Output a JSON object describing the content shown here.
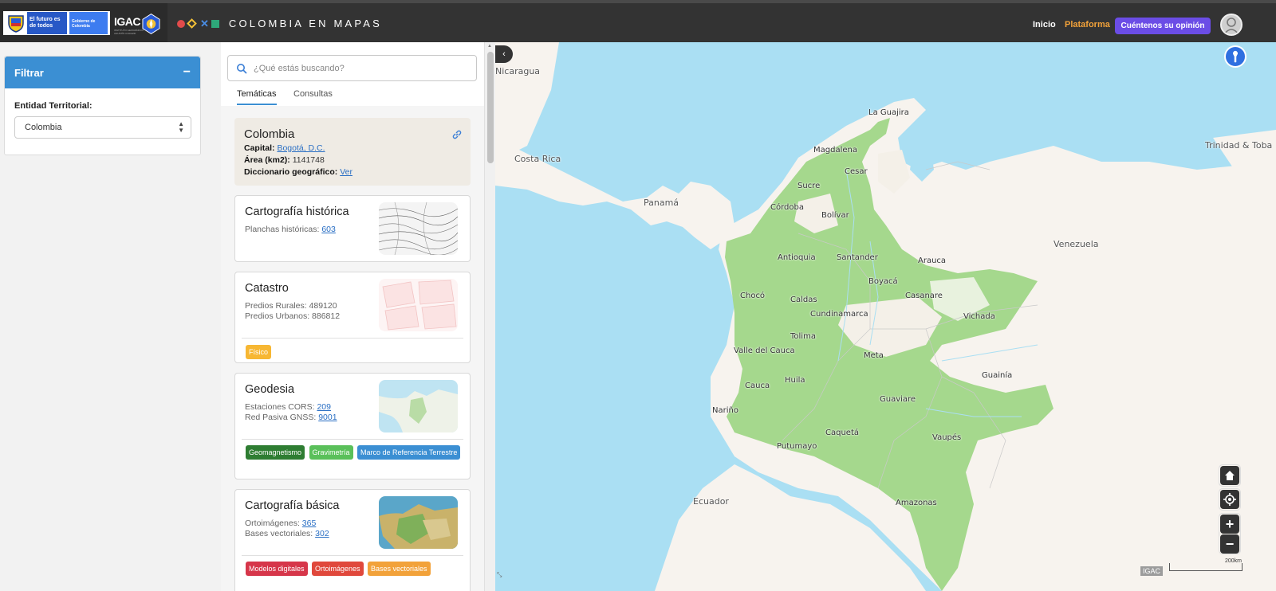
{
  "header": {
    "gov_text_1": "El futuro es de todos",
    "gov_text_2": "Gobierno de Colombia",
    "igac": "IGAC",
    "igac_sub": "INSTITUTO GEOGRÁFICO AGUSTÍN CODAZZI",
    "brand_title": "COLOMBIA EN MAPAS",
    "nav": {
      "inicio": "Inicio",
      "plataforma": "Plataforma"
    },
    "opinion_button": "Cuéntenos su opinión"
  },
  "filter": {
    "title": "Filtrar",
    "collapse_symbol": "−",
    "entity_label": "Entidad Territorial:",
    "entity_value": "Colombia"
  },
  "search": {
    "placeholder": "¿Qué estás buscando?"
  },
  "tabs": {
    "tematicas": "Temáticas",
    "consultas": "Consultas"
  },
  "colombia_card": {
    "title": "Colombia",
    "capital_label": "Capital:",
    "capital_value": "Bogotá, D.C.",
    "area_label": "Área (km2):",
    "area_value": "1141748",
    "dict_label": "Diccionario geográfico:",
    "dict_value": "Ver"
  },
  "cards": {
    "cartografia_historica": {
      "title": "Cartografía histórica",
      "line1_label": "Planchas históricas:",
      "line1_value": "603"
    },
    "catastro": {
      "title": "Catastro",
      "line1": "Predios Rurales: 489120",
      "line2": "Predios Urbanos: 886812",
      "tags": [
        "Físico"
      ]
    },
    "geodesia": {
      "title": "Geodesia",
      "line1_label": "Estaciones CORS:",
      "line1_value": "209",
      "line2_label": "Red Pasiva GNSS:",
      "line2_value": "9001",
      "tags": [
        "Geomagnetismo",
        "Gravimetría",
        "Marco de Referencia Terrestre"
      ]
    },
    "cartografia_basica": {
      "title": "Cartografía básica",
      "line1_label": "Ortoimágenes:",
      "line1_value": "365",
      "line2_label": "Bases vectoriales:",
      "line2_value": "302",
      "tags": [
        "Modelos digitales",
        "Ortoimágenes",
        "Bases vectoriales"
      ]
    }
  },
  "map": {
    "labels": {
      "nicaragua": "Nicaragua",
      "costa_rica": "Costa Rica",
      "panama": "Panamá",
      "venezuela": "Venezuela",
      "trinidad": "Trinidad & Toba",
      "ecuador": "Ecuador",
      "la_guajira": "La Guajira",
      "magdalena": "Magdalena",
      "cesar": "Cesar",
      "sucre": "Sucre",
      "cordoba": "Córdoba",
      "bolivar": "Bolívar",
      "antioquia": "Antioquia",
      "santander": "Santander",
      "arauca": "Arauca",
      "boyaca": "Boyacá",
      "choco": "Chocó",
      "caldas": "Caldas",
      "casanare": "Casanare",
      "cundinamarca": "Cundinamarca",
      "vichada": "Vichada",
      "tolima": "Tolima",
      "valle": "Valle del Cauca",
      "meta": "Meta",
      "cauca": "Cauca",
      "huila": "Huila",
      "guainia": "Guainía",
      "guaviare": "Guaviare",
      "narino": "Nariño",
      "caqueta": "Caquetá",
      "vaupes": "Vaupés",
      "putumayo": "Putumayo",
      "amazonas": "Amazonas"
    },
    "attribution": "IGAC",
    "scale": "200km",
    "zoom_in": "+",
    "zoom_out": "−"
  },
  "colors": {
    "header_bg": "#333333",
    "filter_blue": "#3b8fd3",
    "opinion_purple": "#6b4de6",
    "water": "#aadff3",
    "land": "#f7f3ee",
    "vegetation": "#a5d88d",
    "tag_fisico": "#f7b733",
    "tag_geomagnetismo": "#2e7d32",
    "tag_gravimetria": "#5ac05a",
    "tag_marco": "#3b8fd3",
    "tag_modelos": "#d6364a",
    "tag_ortoimagenes": "#e0483c",
    "tag_bases": "#f2a23a"
  }
}
